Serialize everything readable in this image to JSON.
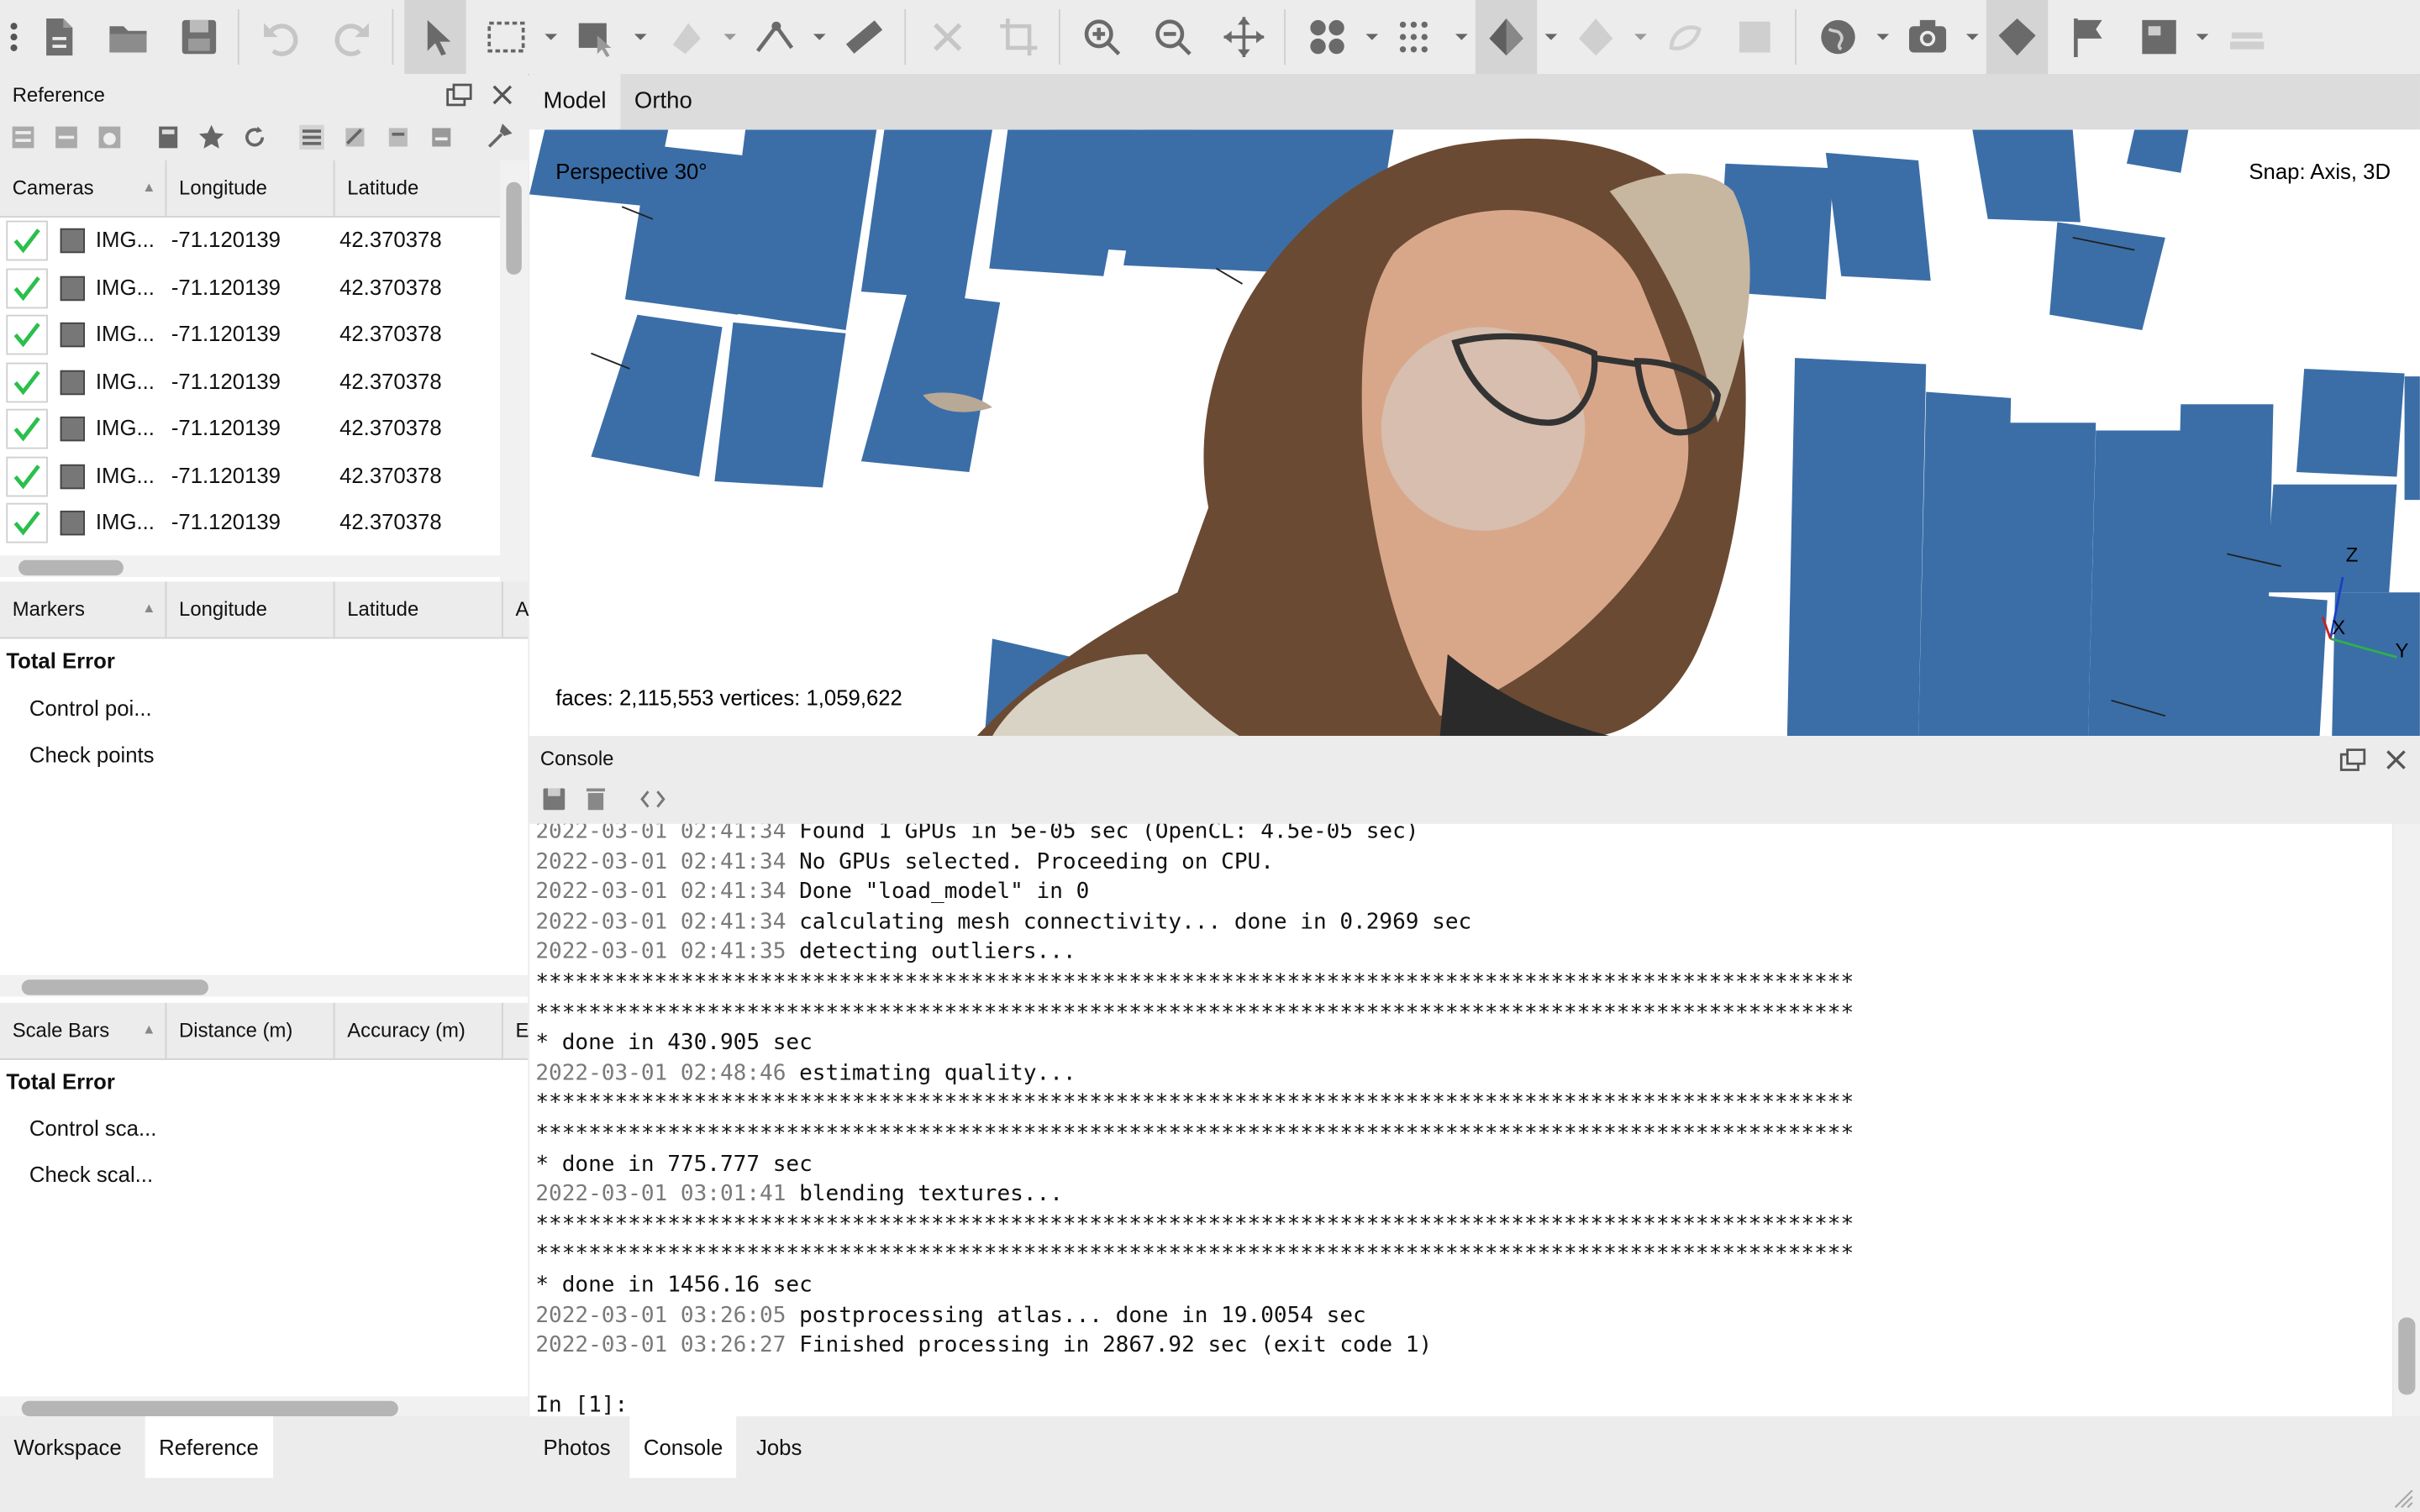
{
  "toolbar": {
    "icons": [
      "menu-dots-icon",
      "new-document-icon",
      "open-folder-icon",
      "save-icon",
      "undo-icon",
      "redo-icon",
      "navigation-arrow-icon",
      "rectangle-selection-icon",
      "free-form-selection-icon",
      "intelligent-paint-icon",
      "ruler-measure-icon",
      "ruler-icon",
      "delete-icon",
      "crop-icon",
      "zoom-in-icon",
      "zoom-out-icon",
      "move-object-icon",
      "show-cameras-icon",
      "point-cloud-icon",
      "shaded-model-icon",
      "solid-model-icon",
      "wireframe-icon",
      "texture-icon",
      "globe-icon",
      "camera-icon",
      "shapes-icon",
      "flag-icon",
      "orthomosaic-icon",
      "layers-icon"
    ]
  },
  "reference_panel": {
    "title": "Reference",
    "cameras_table": {
      "headers": [
        "Cameras",
        "Longitude",
        "Latitude"
      ],
      "rows": [
        {
          "name": "IMG...",
          "longitude": "-71.120139",
          "latitude": "42.370378"
        },
        {
          "name": "IMG...",
          "longitude": "-71.120139",
          "latitude": "42.370378"
        },
        {
          "name": "IMG...",
          "longitude": "-71.120139",
          "latitude": "42.370378"
        },
        {
          "name": "IMG...",
          "longitude": "-71.120139",
          "latitude": "42.370378"
        },
        {
          "name": "IMG...",
          "longitude": "-71.120139",
          "latitude": "42.370378"
        },
        {
          "name": "IMG...",
          "longitude": "-71.120139",
          "latitude": "42.370378"
        },
        {
          "name": "IMG...",
          "longitude": "-71.120139",
          "latitude": "42.370378"
        }
      ]
    },
    "markers_table": {
      "headers": [
        "Markers",
        "Longitude",
        "Latitude",
        "A"
      ],
      "total": "Total Error",
      "items": [
        "Control poi...",
        "Check points"
      ]
    },
    "scalebars_table": {
      "headers": [
        "Scale Bars",
        "Distance (m)",
        "Accuracy (m)",
        "E"
      ],
      "total": "Total Error",
      "items": [
        "Control sca...",
        "Check scal..."
      ]
    }
  },
  "left_tabs": [
    "Workspace",
    "Reference"
  ],
  "viewport": {
    "tabs": [
      "Model",
      "Ortho"
    ],
    "projection": "Perspective 30°",
    "snap": "Snap: Axis, 3D",
    "stats": "faces: 2,115,553 vertices: 1,059,622",
    "axis_labels": {
      "z": "Z",
      "x": "X",
      "y": "Y"
    }
  },
  "console": {
    "title": "Console",
    "lines": [
      {
        "ts": "2022-03-01 02:41:34",
        "text": "Found 1 GPUs in 5e-05 sec (OpenCL: 4.5e-05 sec)"
      },
      {
        "ts": "2022-03-01 02:41:34",
        "text": "No GPUs selected. Proceeding on CPU."
      },
      {
        "ts": "2022-03-01 02:41:34",
        "text": "Done \"load_model\" in 0"
      },
      {
        "ts": "2022-03-01 02:41:34",
        "text": "calculating mesh connectivity... done in 0.2969 sec"
      },
      {
        "ts": "2022-03-01 02:41:35",
        "text": "detecting outliers..."
      },
      {
        "ts": "",
        "text": "****************************************************************************************************"
      },
      {
        "ts": "",
        "text": "****************************************************************************************************"
      },
      {
        "ts": "",
        "text": "* done in 430.905 sec"
      },
      {
        "ts": "2022-03-01 02:48:46",
        "text": "estimating quality..."
      },
      {
        "ts": "",
        "text": "****************************************************************************************************"
      },
      {
        "ts": "",
        "text": "****************************************************************************************************"
      },
      {
        "ts": "",
        "text": "* done in 775.777 sec"
      },
      {
        "ts": "2022-03-01 03:01:41",
        "text": "blending textures..."
      },
      {
        "ts": "",
        "text": "****************************************************************************************************"
      },
      {
        "ts": "",
        "text": "****************************************************************************************************"
      },
      {
        "ts": "",
        "text": "* done in 1456.16 sec"
      },
      {
        "ts": "2022-03-01 03:26:05",
        "text": "postprocessing atlas... done in 19.0054 sec"
      },
      {
        "ts": "2022-03-01 03:26:27",
        "text": "Finished processing in 2867.92 sec (exit code 1)"
      },
      {
        "ts": "",
        "text": ""
      },
      {
        "ts": "",
        "text": "In [1]:"
      }
    ]
  },
  "bottom_tabs": [
    "Photos",
    "Console",
    "Jobs"
  ]
}
